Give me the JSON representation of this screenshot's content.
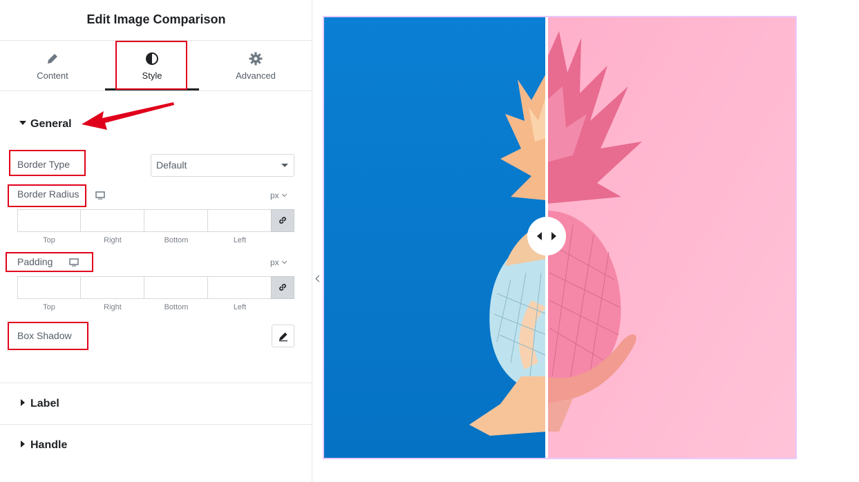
{
  "panel": {
    "title": "Edit Image Comparison",
    "tabs": [
      {
        "label": "Content",
        "icon": "pencil-icon"
      },
      {
        "label": "Style",
        "icon": "half-circle-icon",
        "active": true
      },
      {
        "label": "Advanced",
        "icon": "gear-icon"
      }
    ]
  },
  "general": {
    "label": "General",
    "expanded": true,
    "border_type": {
      "label": "Border Type",
      "value": "Default"
    },
    "border_radius": {
      "label": "Border Radius",
      "unit": "px",
      "values": [
        "",
        "",
        "",
        ""
      ]
    },
    "padding": {
      "label": "Padding",
      "unit": "px",
      "values": [
        "",
        "",
        "",
        ""
      ]
    },
    "dim_labels": [
      "Top",
      "Right",
      "Bottom",
      "Left"
    ],
    "box_shadow": {
      "label": "Box Shadow"
    }
  },
  "sections": [
    {
      "label": "Label",
      "expanded": false
    },
    {
      "label": "Handle",
      "expanded": false
    }
  ],
  "colors": {
    "accent_red": "#e0001b",
    "before_bg": "#0a82d6",
    "after_bg": "#ffb5d0",
    "preview_border": "#e8c9ff"
  },
  "preview": {
    "before_image": "peach-blue-painted-pineapple",
    "after_image": "pink-painted-pineapple-on-hand",
    "handle_icon": "left-right-arrows-icon"
  }
}
